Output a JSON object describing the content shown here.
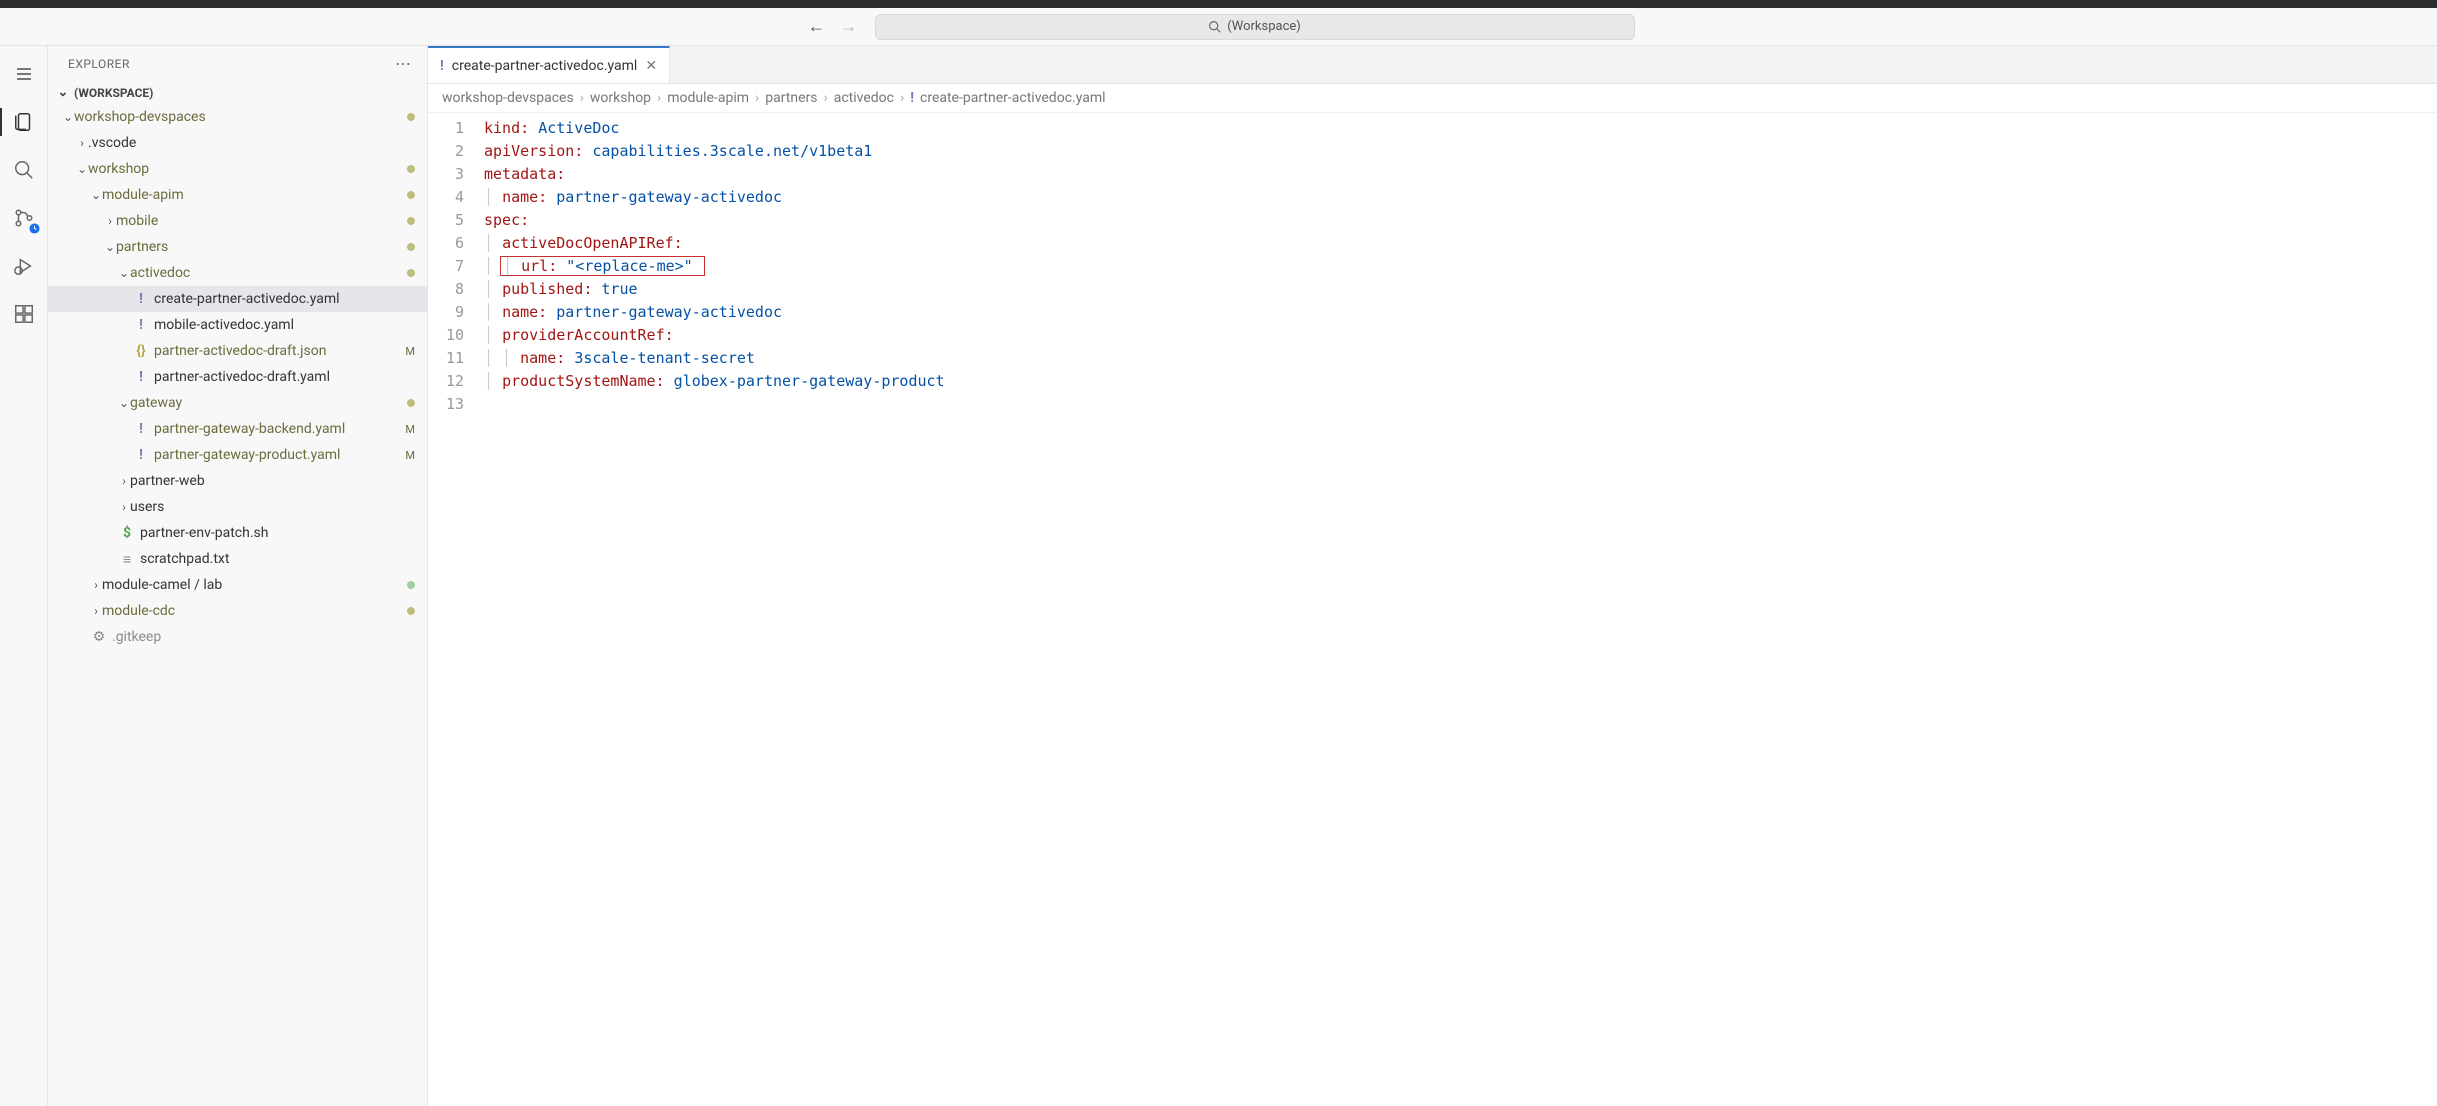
{
  "topbar": {
    "search_placeholder": "(Workspace)"
  },
  "sidebar": {
    "title": "EXPLORER",
    "section": "(WORKSPACE)"
  },
  "tree": {
    "root": "workshop-devspaces",
    "vscode": ".vscode",
    "workshop": "workshop",
    "module_apim": "module-apim",
    "mobile": "mobile",
    "partners": "partners",
    "activedoc": "activedoc",
    "file_create": "create-partner-activedoc.yaml",
    "file_mobile": "mobile-activedoc.yaml",
    "file_draft_json": "partner-activedoc-draft.json",
    "file_draft_yaml": "partner-activedoc-draft.yaml",
    "gateway": "gateway",
    "file_backend": "partner-gateway-backend.yaml",
    "file_product": "partner-gateway-product.yaml",
    "partner_web": "partner-web",
    "users": "users",
    "file_env": "partner-env-patch.sh",
    "file_scratch": "scratchpad.txt",
    "module_camel": "module-camel",
    "module_camel_sub": "lab",
    "module_cdc": "module-cdc",
    "gitkeep": ".gitkeep",
    "badge_m": "M"
  },
  "tab": {
    "label": "create-partner-activedoc.yaml"
  },
  "breadcrumbs": {
    "p0": "workshop-devspaces",
    "p1": "workshop",
    "p2": "module-apim",
    "p3": "partners",
    "p4": "activedoc",
    "p5": "create-partner-activedoc.yaml"
  },
  "gutter": {
    "l1": "1",
    "l2": "2",
    "l3": "3",
    "l4": "4",
    "l5": "5",
    "l6": "6",
    "l7": "7",
    "l8": "8",
    "l9": "9",
    "l10": "10",
    "l11": "11",
    "l12": "12",
    "l13": "13"
  },
  "code": {
    "l1k": "kind:",
    "l1v": "ActiveDoc",
    "l2k": "apiVersion:",
    "l2v": "capabilities.3scale.net/v1beta1",
    "l3k": "metadata:",
    "l4k": "name:",
    "l4v": "partner-gateway-activedoc",
    "l5k": "spec:",
    "l6k": "activeDocOpenAPIRef:",
    "l7k": "url:",
    "l7v": "\"<replace-me>\"",
    "l8k": "published:",
    "l8v": "true",
    "l9k": "name:",
    "l9v": "partner-gateway-activedoc",
    "l10k": "providerAccountRef:",
    "l11k": "name:",
    "l11v": "3scale-tenant-secret",
    "l12k": "productSystemName:",
    "l12v": "globex-partner-gateway-product"
  }
}
